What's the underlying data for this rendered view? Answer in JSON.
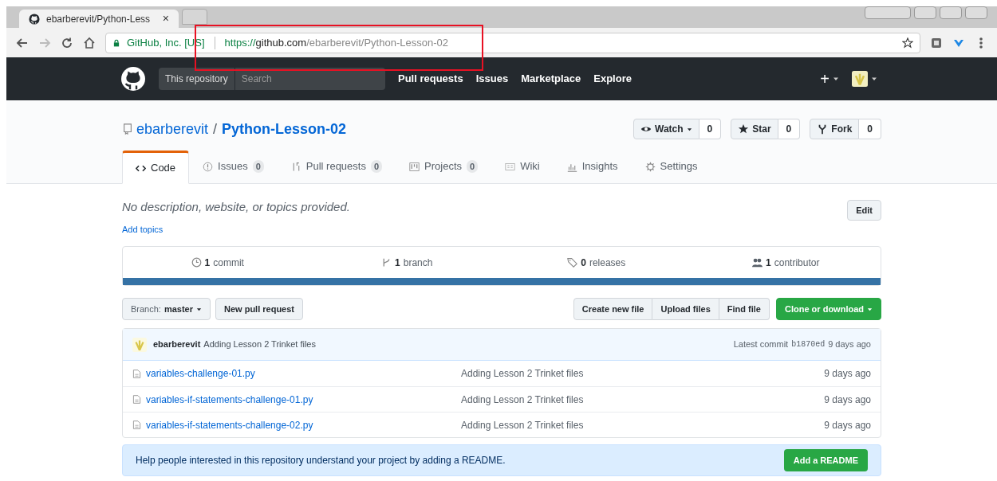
{
  "browser": {
    "tab_title": "ebarberevit/Python-Less",
    "tab_close": "×",
    "security_label": "GitHub, Inc. [US]",
    "url_scheme": "https://",
    "url_host": "github.com",
    "url_path": "/ebarberevit/Python-Lesson-02",
    "highlight_box": true
  },
  "nav": {
    "scope": "This repository",
    "search_placeholder": "Search",
    "links": [
      "Pull requests",
      "Issues",
      "Marketplace",
      "Explore"
    ],
    "plus": "+"
  },
  "repo": {
    "owner": "ebarberevit",
    "separator": "/",
    "name": "Python-Lesson-02",
    "actions": [
      {
        "label": "Watch",
        "count": "0",
        "dropdown": true
      },
      {
        "label": "Star",
        "count": "0",
        "dropdown": false
      },
      {
        "label": "Fork",
        "count": "0",
        "dropdown": false
      }
    ]
  },
  "tabs": [
    {
      "label": "Code",
      "selected": true
    },
    {
      "label": "Issues",
      "count": "0",
      "selected": false
    },
    {
      "label": "Pull requests",
      "count": "0",
      "selected": false
    },
    {
      "label": "Projects",
      "count": "0",
      "selected": false
    },
    {
      "label": "Wiki",
      "selected": false
    },
    {
      "label": "Insights",
      "selected": false
    },
    {
      "label": "Settings",
      "selected": false
    }
  ],
  "description": "No description, website, or topics provided.",
  "add_topics": "Add topics",
  "edit_button": "Edit",
  "stats": [
    {
      "count": "1",
      "label": "commit"
    },
    {
      "count": "1",
      "label": "branch"
    },
    {
      "count": "0",
      "label": "releases"
    },
    {
      "count": "1",
      "label": "contributor"
    }
  ],
  "toolbar": {
    "branch_label": "Branch:",
    "branch": "master",
    "new_pr": "New pull request",
    "buttons": [
      "Create new file",
      "Upload files",
      "Find file"
    ],
    "clone": "Clone or download"
  },
  "latest_commit": {
    "author": "ebarberevit",
    "message": "Adding Lesson 2 Trinket files",
    "prefix": "Latest commit",
    "sha": "b1870ed",
    "age": "9 days ago"
  },
  "files": [
    {
      "name": "variables-challenge-01.py",
      "message": "Adding Lesson 2 Trinket files",
      "age": "9 days ago"
    },
    {
      "name": "variables-if-statements-challenge-01.py",
      "message": "Adding Lesson 2 Trinket files",
      "age": "9 days ago"
    },
    {
      "name": "variables-if-statements-challenge-02.py",
      "message": "Adding Lesson 2 Trinket files",
      "age": "9 days ago"
    }
  ],
  "readme_banner": {
    "text": "Help people interested in this repository understand your project by adding a README.",
    "button": "Add a README"
  }
}
